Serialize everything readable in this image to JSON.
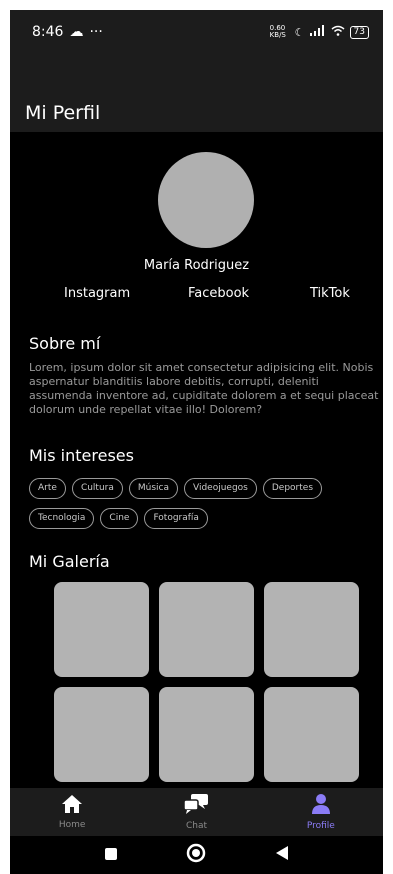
{
  "status": {
    "time": "8:46",
    "cloud": "☁",
    "dots": "···",
    "speed": "0.60 KB/S",
    "battery": "73"
  },
  "appbar": {
    "title": "Mi Perfil"
  },
  "profile": {
    "name": "María Rodriguez",
    "socials": [
      "Instagram",
      "Facebook",
      "TikTok"
    ]
  },
  "about": {
    "heading": "Sobre mí",
    "text": "Lorem, ipsum dolor sit amet consectetur adipisicing elit. Nobis aspernatur blanditiis labore debitis, corrupti, deleniti assumenda inventore ad, cupiditate dolorem a et sequi placeat dolorum unde repellat vitae illo! Dolorem?"
  },
  "interests": {
    "heading": "Mis intereses",
    "items": [
      "Arte",
      "Cultura",
      "Música",
      "Videojuegos",
      "Deportes",
      "Tecnologia",
      "Cine",
      "Fotografía"
    ]
  },
  "gallery": {
    "heading": "Mi Galería"
  },
  "nav": {
    "items": [
      {
        "label": "Home",
        "icon": "home-icon"
      },
      {
        "label": "Chat",
        "icon": "chat-icon"
      },
      {
        "label": "Profile",
        "icon": "profile-icon"
      }
    ],
    "active": "Profile"
  },
  "colors": {
    "accent": "#8b7cf6",
    "tile": "#b3b3b3",
    "bar": "#1c1c1c"
  }
}
